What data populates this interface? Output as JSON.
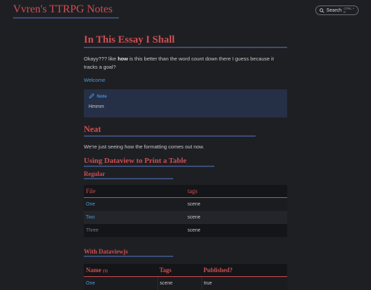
{
  "site": {
    "title": "Vvren's TTRPG Notes",
    "search_label": "Search",
    "search_shortcut": "CTRL + K"
  },
  "page": {
    "title": "In This Essay I Shall",
    "intro_text_pre": "Okayy??? like ",
    "intro_bold": "how",
    "intro_text_post": " is this better than the word count down there I guess because it tracks a goal?",
    "welcome_link": "Welcome",
    "callout": {
      "title": "Note",
      "body": "Hmmm"
    },
    "heading_neat": "Neat",
    "neat_text": "We're just seeing how the formatting comes out now.",
    "heading_dataview": "Using Dataview to Print a Table",
    "heading_regular": "Regular",
    "table1": {
      "headers": [
        "File",
        "tags"
      ],
      "rows": [
        {
          "file": "One",
          "tags": "scene"
        },
        {
          "file": "Two",
          "tags": "scene"
        },
        {
          "file": "Three",
          "tags": "scene"
        }
      ]
    },
    "heading_dataviewjs": "With Dataviewjs",
    "table2": {
      "headers": [
        "Name",
        "Tags",
        "Published?"
      ],
      "name_count": "(3)",
      "rows": [
        {
          "name": "One",
          "tags": "scene",
          "published": "true"
        }
      ]
    }
  },
  "colors": {
    "accent_red": "#d04e52",
    "link_blue": "#4f9ad6",
    "underline_blue": "#3b4e78",
    "background": "#1e1f23"
  },
  "icons": {
    "search": "search-icon",
    "note": "pencil-icon"
  }
}
